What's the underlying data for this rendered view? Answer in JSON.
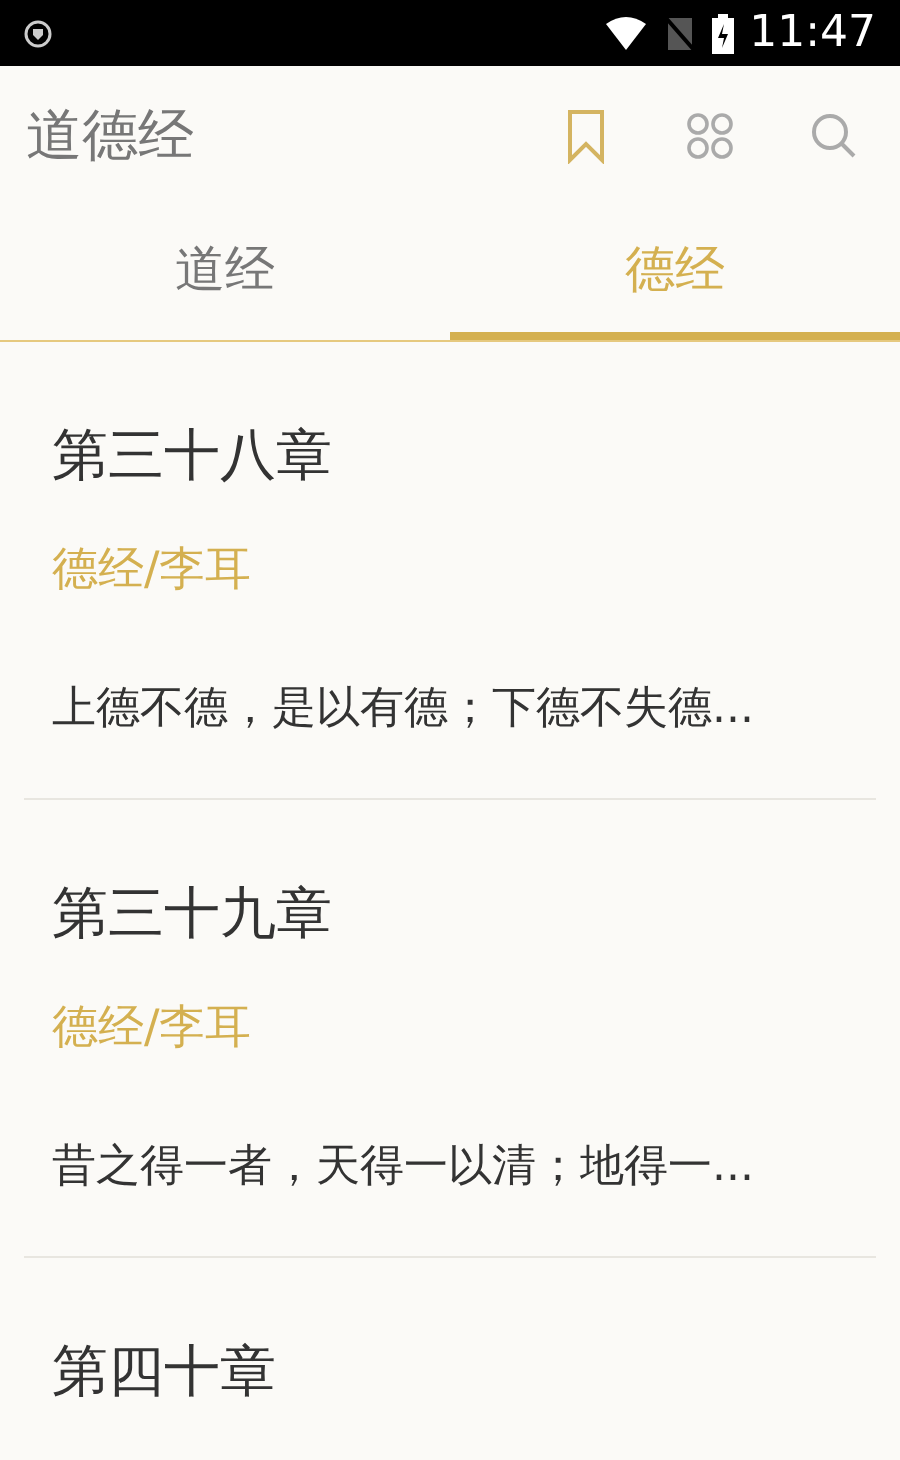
{
  "status_bar": {
    "time": "11:47"
  },
  "app_bar": {
    "title": "道德经"
  },
  "tabs": [
    {
      "label": "道经",
      "selected": false
    },
    {
      "label": "德经",
      "selected": true
    }
  ],
  "chapters": [
    {
      "title": "第三十八章",
      "source": "德经/李耳",
      "excerpt": "上德不德，是以有德；下德不失德..."
    },
    {
      "title": "第三十九章",
      "source": "德经/李耳",
      "excerpt": "昔之得一者，天得一以清；地得一..."
    },
    {
      "title": "第四十章"
    }
  ]
}
